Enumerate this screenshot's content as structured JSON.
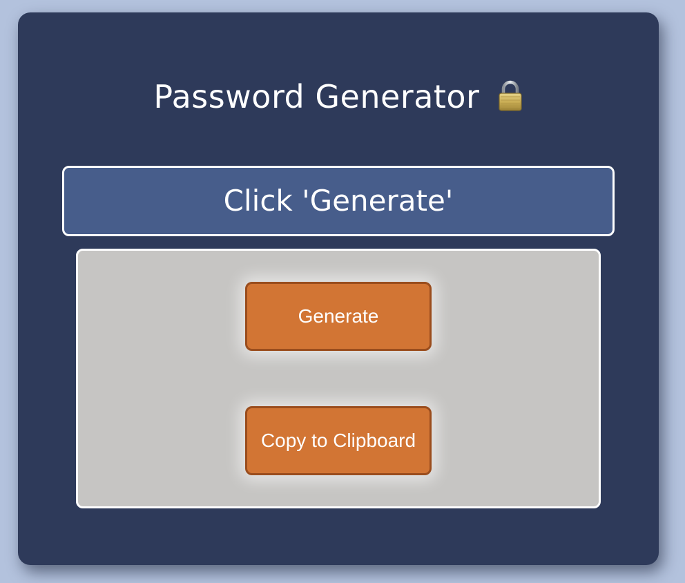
{
  "app": {
    "title": "Password Generator",
    "title_icon": "lock-icon"
  },
  "output": {
    "text": "Click 'Generate'"
  },
  "buttons": {
    "generate_label": "Generate",
    "copy_label": "Copy to Clipboard"
  },
  "colors": {
    "page_background": "#b3c2dd",
    "card_background": "#2e3a5a",
    "output_background": "#475d8b",
    "panel_background": "#c6c5c3",
    "button_background": "#d27534",
    "button_border": "#9a4d1d"
  }
}
